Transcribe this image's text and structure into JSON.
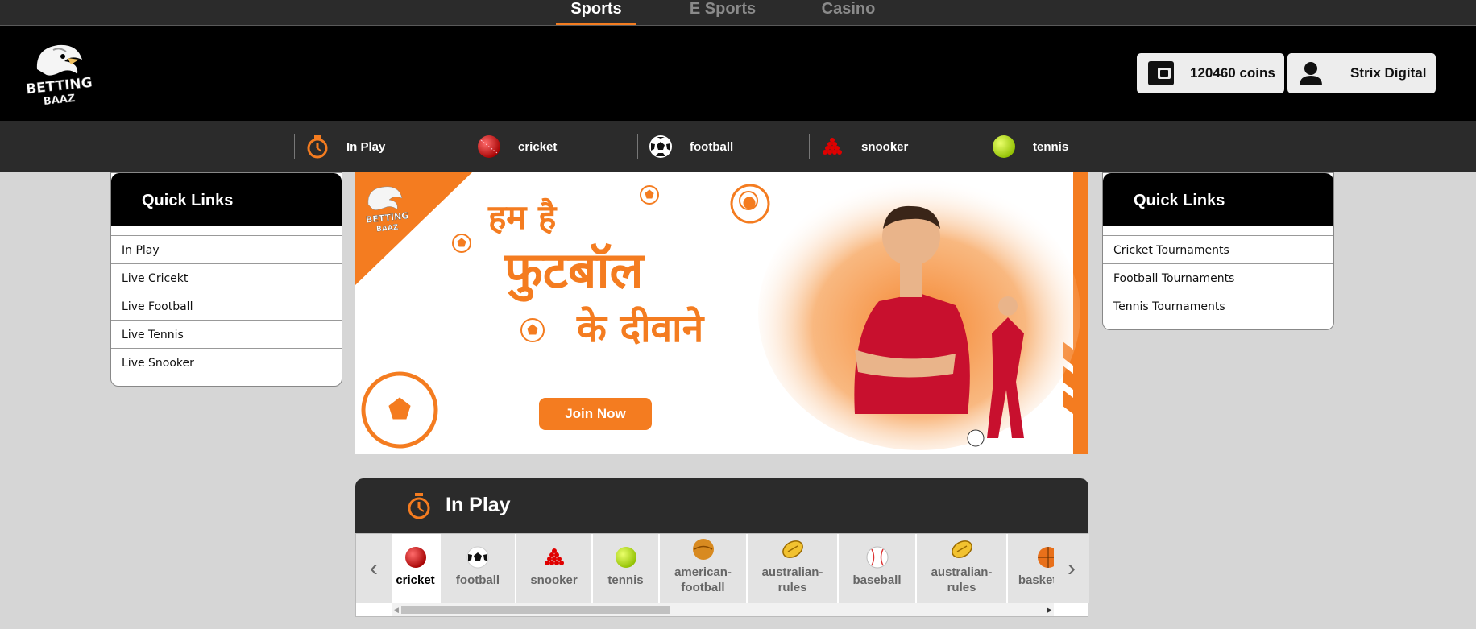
{
  "top_tabs": [
    {
      "label": "Sports",
      "active": true
    },
    {
      "label": "E Sports",
      "active": false
    },
    {
      "label": "Casino",
      "active": false
    }
  ],
  "header": {
    "logo_text_line1": "BETTING",
    "logo_text_line2": "BAAZ",
    "coins_label": "120460 coins",
    "user_name": "Strix Digital"
  },
  "sports_nav": [
    {
      "label": "In Play",
      "icon": "stopwatch-icon"
    },
    {
      "label": "cricket",
      "icon": "cricket-ball-icon"
    },
    {
      "label": "football",
      "icon": "football-icon"
    },
    {
      "label": "snooker",
      "icon": "snooker-balls-icon"
    },
    {
      "label": "tennis",
      "icon": "tennis-ball-icon"
    }
  ],
  "quick_links_left": {
    "title": "Quick Links",
    "items": [
      "In Play",
      "Live Cricekt",
      "Live Football",
      "Live Tennis",
      "Live Snooker"
    ]
  },
  "quick_links_right": {
    "title": "Quick Links",
    "items": [
      "Cricket Tournaments",
      "Football Tournaments",
      "Tennis Tournaments"
    ]
  },
  "banner": {
    "line1": "हम है",
    "line2": "फुटबॉल",
    "line3": "के दीवाने",
    "join_label": "Join Now"
  },
  "in_play": {
    "title": "In Play",
    "sports": [
      {
        "label": "cricket",
        "active": true,
        "icon": "cricket-ball-icon"
      },
      {
        "label": "football",
        "active": false,
        "icon": "football-icon"
      },
      {
        "label": "snooker",
        "active": false,
        "icon": "snooker-balls-icon"
      },
      {
        "label": "tennis",
        "active": false,
        "icon": "tennis-ball-icon"
      },
      {
        "label": "american-football",
        "active": false,
        "icon": "american-football-icon"
      },
      {
        "label": "australian-rules",
        "active": false,
        "icon": "rugby-ball-icon"
      },
      {
        "label": "baseball",
        "active": false,
        "icon": "baseball-icon"
      },
      {
        "label": "australian-rules",
        "active": false,
        "icon": "rugby-ball-icon"
      },
      {
        "label": "basketball",
        "active": false,
        "icon": "basketball-icon"
      }
    ]
  },
  "colors": {
    "accent": "#f47c20",
    "dark_bar": "#2b2b2b",
    "header_bg": "#000000",
    "page_bg": "#d6d6d6"
  }
}
